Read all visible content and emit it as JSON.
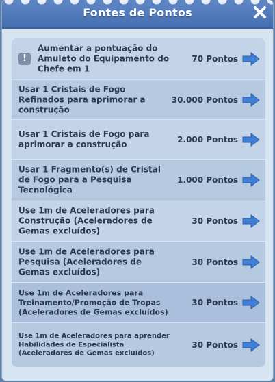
{
  "dialog": {
    "title": "Fontes de Pontos",
    "close_icon": "close-icon"
  },
  "rows": [
    {
      "label": "Aumentar a pontuação do Amuleto do Equipamento do Chefe em 1",
      "points": "70 Pontos",
      "icon": "exclamation-icon"
    },
    {
      "label": "Usar 1 Cristais de Fogo Refinados para aprimorar a construção",
      "points": "30.000 Pontos"
    },
    {
      "label": "Usar 1 Cristais de Fogo para aprimorar a construção",
      "points": "2.000 Pontos"
    },
    {
      "label": "Usar 1 Fragmento(s) de Cristal de Fogo para a Pesquisa Tecnológica",
      "points": "1.000 Pontos"
    },
    {
      "label": "Use 1m de Aceleradores para Construção (Aceleradores de Gemas excluídos)",
      "points": "30 Pontos"
    },
    {
      "label": "Use 1m de Aceleradores para Pesquisa (Aceleradores de Gemas excluídos)",
      "points": "30 Pontos"
    },
    {
      "label": "Use 1m de Aceleradores para Treinamento/Promoção de Tropas (Aceleradores de Gemas excluídos)",
      "points": "30 Pontos"
    },
    {
      "label": "Use 1m de Aceleradores para aprender Habilidades de Especialista (Aceleradores de Gemas excluídos)",
      "points": "30 Pontos"
    }
  ],
  "colors": {
    "header": "#4f78b8",
    "arrow": "#3f7fd6",
    "text": "#2d3b52"
  }
}
